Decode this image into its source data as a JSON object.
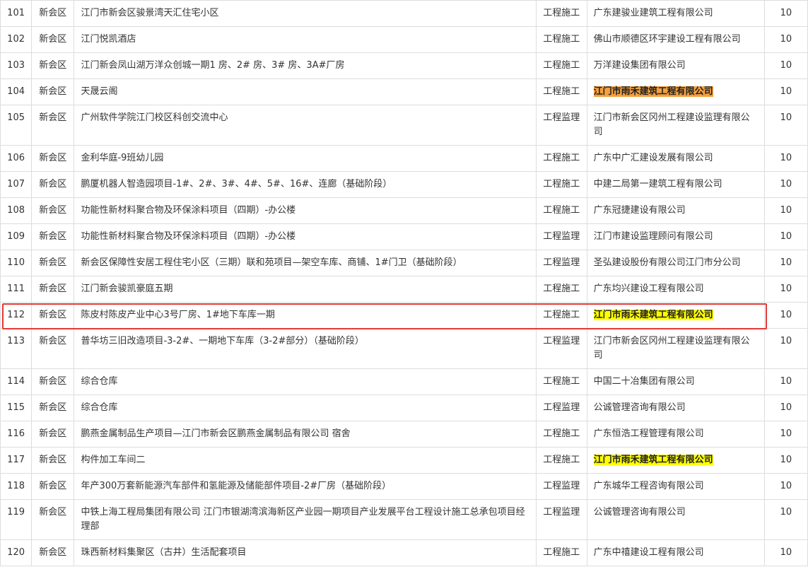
{
  "rows": [
    {
      "no": "101",
      "district": "新会区",
      "project": "江门市新会区骏景湾天汇住宅小区",
      "type": "工程施工",
      "company": "广东建骏业建筑工程有限公司",
      "score": "10"
    },
    {
      "no": "102",
      "district": "新会区",
      "project": "江门悦凯酒店",
      "type": "工程施工",
      "company": "佛山市顺德区环宇建设工程有限公司",
      "score": "10"
    },
    {
      "no": "103",
      "district": "新会区",
      "project": "江门新会凤山湖万洋众创城一期1 房、2# 房、3# 房、3A#厂房",
      "type": "工程施工",
      "company": "万洋建设集团有限公司",
      "score": "10"
    },
    {
      "no": "104",
      "district": "新会区",
      "project": "天晟云阁",
      "type": "工程施工",
      "company": "江门市雨禾建筑工程有限公司",
      "score": "10",
      "highlight": "#f4a03d"
    },
    {
      "no": "105",
      "district": "新会区",
      "project": "广州软件学院江门校区科创交流中心",
      "type": "工程监理",
      "company": "江门市新会区冈州工程建设监理有限公司",
      "score": "10"
    },
    {
      "no": "106",
      "district": "新会区",
      "project": "金利华庭-9班幼儿园",
      "type": "工程施工",
      "company": "广东中广汇建设发展有限公司",
      "score": "10"
    },
    {
      "no": "107",
      "district": "新会区",
      "project": "鹏厦机器人智造园项目-1#、2#、3#、4#、5#、16#、连廊（基础阶段）",
      "type": "工程施工",
      "company": "中建二局第一建筑工程有限公司",
      "score": "10"
    },
    {
      "no": "108",
      "district": "新会区",
      "project": "功能性新材料聚合物及环保涂料项目（四期）-办公楼",
      "type": "工程施工",
      "company": "广东冠捷建设有限公司",
      "score": "10"
    },
    {
      "no": "109",
      "district": "新会区",
      "project": "功能性新材料聚合物及环保涂料项目（四期）-办公楼",
      "type": "工程监理",
      "company": "江门市建设监理顾问有限公司",
      "score": "10"
    },
    {
      "no": "110",
      "district": "新会区",
      "project": "新会区保障性安居工程住宅小区（三期）联和苑项目—架空车库、商铺、1#门卫（基础阶段）",
      "type": "工程监理",
      "company": "圣弘建设股份有限公司江门市分公司",
      "score": "10"
    },
    {
      "no": "111",
      "district": "新会区",
      "project": "江门新会骏凯豪庭五期",
      "type": "工程施工",
      "company": "广东均兴建设工程有限公司",
      "score": "10"
    },
    {
      "no": "112",
      "district": "新会区",
      "project": "陈皮村陈皮产业中心3号厂房、1#地下车库一期",
      "type": "工程施工",
      "company": "江门市雨禾建筑工程有限公司",
      "score": "10",
      "highlight": "#ffff00"
    },
    {
      "no": "113",
      "district": "新会区",
      "project": "普华坊三旧改造项目-3-2#、一期地下车库（3-2#部分）（基础阶段）",
      "type": "工程监理",
      "company": "江门市新会区冈州工程建设监理有限公司",
      "score": "10"
    },
    {
      "no": "114",
      "district": "新会区",
      "project": "综合仓库",
      "type": "工程施工",
      "company": "中国二十冶集团有限公司",
      "score": "10"
    },
    {
      "no": "115",
      "district": "新会区",
      "project": "综合仓库",
      "type": "工程监理",
      "company": "公诚管理咨询有限公司",
      "score": "10"
    },
    {
      "no": "116",
      "district": "新会区",
      "project": "鹏燕金属制品生产项目—江门市新会区鹏燕金属制品有限公司 宿舍",
      "type": "工程施工",
      "company": "广东恒浩工程管理有限公司",
      "score": "10"
    },
    {
      "no": "117",
      "district": "新会区",
      "project": "构件加工车间二",
      "type": "工程施工",
      "company": "江门市雨禾建筑工程有限公司",
      "score": "10",
      "highlight": "#ffff00"
    },
    {
      "no": "118",
      "district": "新会区",
      "project": "年产300万套新能源汽车部件和氢能源及储能部件项目-2#厂房（基础阶段）",
      "type": "工程监理",
      "company": "广东城华工程咨询有限公司",
      "score": "10"
    },
    {
      "no": "119",
      "district": "新会区",
      "project": "中铁上海工程局集团有限公司 江门市银湖湾滨海新区产业园一期项目产业发展平台工程设计施工总承包项目经理部",
      "type": "工程监理",
      "company": "公诚管理咨询有限公司",
      "score": "10"
    },
    {
      "no": "120",
      "district": "新会区",
      "project": "珠西新材料集聚区（古井）生活配套项目",
      "type": "工程施工",
      "company": "广东中禧建设工程有限公司",
      "score": "10"
    }
  ]
}
